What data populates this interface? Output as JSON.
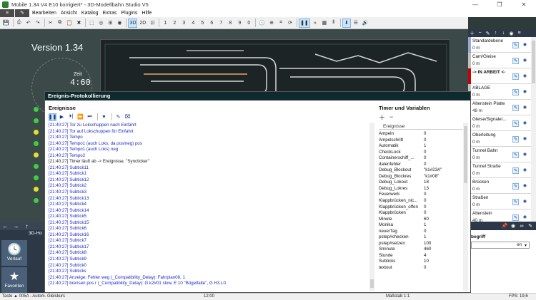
{
  "window": {
    "title": "Mobile 1.34 V4 E10 korrigiert* - 3D-Modellbahn Studio V5"
  },
  "menu": {
    "items": [
      "Bearbeiten",
      "Ansicht",
      "Katalog",
      "Extras",
      "Plugins",
      "Hilfe"
    ]
  },
  "toolbar": {
    "btn_3d": "3D",
    "btn_2d": "2D",
    "numbers": [
      "1",
      "2",
      "3",
      "4",
      "5",
      "6",
      "7",
      "8",
      "9",
      "0"
    ]
  },
  "viewport": {
    "version": "Version 1.34",
    "clock_label": "Zeit",
    "clock_time": "4:60"
  },
  "dialog": {
    "title": "Ereignis-Protokollierung",
    "events_title": "Ereignisse",
    "vars_title": "Timer und Variablen",
    "vars_group": "Ereignisse"
  },
  "log_lines": [
    "[21:40:27]    Tor zu Lokschuppen nach Einfahrt",
    "[21:40:27]    Tor auf Lokschuppen für Einfahrt",
    "[21:40:27]    Tempo",
    "[21:40:27]    Tempo1 (auch Loks, da pos/neg) pos",
    "[21:40:27]    Tempo1 (auch Loks) neg",
    "[21:40:27]    Tempo2",
    "[21:40:27] Timer läuft ab -> Ereignisse, \"Syncticker\"",
    "[21:40:27]    Subtick11",
    "[21:40:27]    Subtick1",
    "[21:40:27]    Subtick12",
    "[21:40:27]    Subtick2",
    "[21:40:27]    Subtick3",
    "[21:40:27]    Subtick13",
    "[21:40:27]    Subtick4",
    "[21:40:27]    Subtick14",
    "[21:40:27]    Subtick5",
    "[21:40:27]    Subtick15",
    "[21:40:27]    Subtick6",
    "[21:40:27]    Subtick16",
    "[21:40:27]    Subtick7",
    "[21:40:27]    Subtick17",
    "[21:40:27]    Subtick8",
    "[21:40:27]    Subtick9",
    "[21:40:27]    Subtick0",
    "[21:40:27]    Subticks",
    "[21:40:27] Anzeige: Fehler weg (_Compatibility_Delay): Fahrplan08, 1",
    "[21:40:27] brensen pos r (_Compatibility_Delay): G k2#01 slow, E 10 \"Bügelfalte\", G H3.L0"
  ],
  "variables": [
    {
      "name": "Ampeln",
      "value": "0"
    },
    {
      "name": "Ampelschritt",
      "value": "0"
    },
    {
      "name": "Automatik",
      "value": "1"
    },
    {
      "name": "CheckLock",
      "value": "0"
    },
    {
      "name": "Containerschiff_...",
      "value": "0"
    },
    {
      "name": "datenfehler",
      "value": "0"
    },
    {
      "name": "Debug_Blockout",
      "value": "\"k1#23A\""
    },
    {
      "name": "Debug_Blockres",
      "value": "\"k1#08\""
    },
    {
      "name": "Debug_Lokout",
      "value": "18"
    },
    {
      "name": "Debug_Lokres",
      "value": "13"
    },
    {
      "name": "Feuerwerk",
      "value": "0"
    },
    {
      "name": "Klappbrücken_nic...",
      "value": "0"
    },
    {
      "name": "Klappbrücken_offen",
      "value": "0"
    },
    {
      "name": "Klappbrücken",
      "value": "0"
    },
    {
      "name": "Minute",
      "value": "60"
    },
    {
      "name": "Monika",
      "value": "1"
    },
    {
      "name": "neuerTag",
      "value": "0"
    },
    {
      "name": "pstep#checken",
      "value": "1"
    },
    {
      "name": "pstep#setzen",
      "value": "100"
    },
    {
      "name": "Sminute",
      "value": "460"
    },
    {
      "name": "Stunde",
      "value": "4"
    },
    {
      "name": "Subticks",
      "value": "10"
    },
    {
      "name": "textout",
      "value": "0"
    }
  ],
  "layers": [
    {
      "name": "Standardebene",
      "sub": "0 m",
      "color": "#9aa7d8"
    },
    {
      "name": "Cam/Gleise",
      "sub": "0 m",
      "color": "#c0c0c0"
    },
    {
      "name": "-> IN ARBEIT <-",
      "sub": "",
      "color": "#cc0000"
    },
    {
      "name": "ABLAGE",
      "sub": "0 m",
      "color": "#c0c0c0"
    },
    {
      "name": "Altenstein Platte",
      "sub": "48 m",
      "color": "#c0c0c0"
    },
    {
      "name": "Gleise/Signale/...",
      "sub": "0 m",
      "color": "#c0c0c0"
    },
    {
      "name": "Oberleitung",
      "sub": "0 m",
      "color": "#c0c0c0"
    },
    {
      "name": "Tunnel Bahn",
      "sub": "0 m",
      "color": "#c0c0c0"
    },
    {
      "name": "Tunnel Straße",
      "sub": "0 m",
      "color": "#c0c0c0"
    },
    {
      "name": "Brücken",
      "sub": "0 m",
      "color": "#c0c0c0"
    },
    {
      "name": "Straßen",
      "sub": "0 m",
      "color": "#c0c0c0"
    },
    {
      "name": "Altenstein",
      "sub": "40 m",
      "color": "#c0c0c0"
    },
    {
      "name": "am Berg",
      "sub": "0 m",
      "color": "#c0c0c0"
    },
    {
      "name": "Harlingen",
      "sub": "0 m",
      "color": "#c0c0c0"
    }
  ],
  "left_panel": {
    "tab": "3D-Ho",
    "btn_verlauf": "Verlauf",
    "btn_favoriten": "Favoriten"
  },
  "right_lower": {
    "label": "begriff",
    "select": "en"
  },
  "status": {
    "left": "Taste ▲ 005A - Autom. Gleiskurs",
    "center": "12:00",
    "center2": "Maßstab 1:1",
    "right": "FPS: 19,6"
  },
  "colors": {
    "accent": "#cce4f7",
    "dialog_title": "#0f2a2e",
    "log_text": "#1f2bbf"
  },
  "icons": {
    "save": "save-icon",
    "print": "print-icon",
    "cut": "cut-icon",
    "copy": "copy-icon",
    "pause": "pause-icon",
    "play": "play-icon",
    "step": "step-icon",
    "filter": "filter-icon",
    "edit": "pencil-icon",
    "clear": "clear-icon",
    "add": "plus-icon",
    "remove": "minus-icon",
    "visibility": "eye-icon",
    "pin": "pin-icon"
  }
}
